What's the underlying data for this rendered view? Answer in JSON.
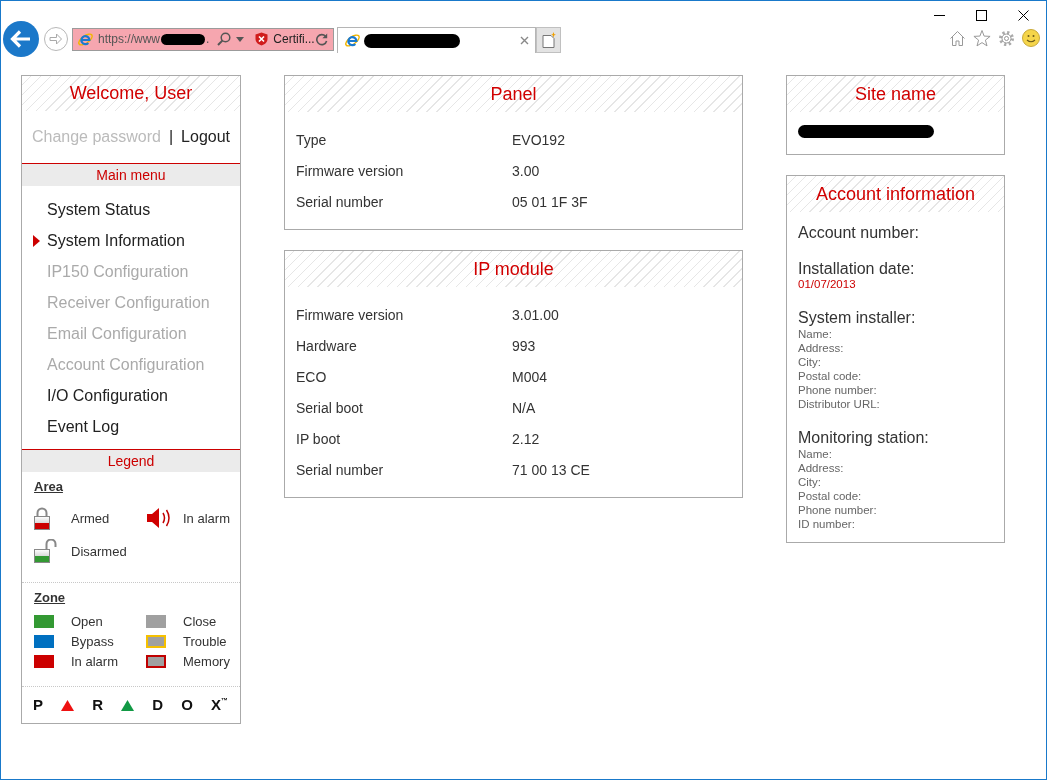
{
  "browser": {
    "address": {
      "url": "https://www",
      "url_end": ".",
      "status": "Certifi..."
    }
  },
  "sidebar": {
    "welcome": "Welcome, User",
    "account_links": [
      {
        "label": "Change password",
        "disabled": true
      },
      {
        "label": "Logout",
        "disabled": false
      }
    ],
    "link_separator": "|",
    "menu_title": "Main menu",
    "menu": [
      {
        "label": "System Status",
        "selected": false,
        "disabled": false
      },
      {
        "label": "System Information",
        "selected": true,
        "disabled": false
      },
      {
        "label": "IP150 Configuration",
        "selected": false,
        "disabled": true
      },
      {
        "label": "Receiver Configuration",
        "selected": false,
        "disabled": true
      },
      {
        "label": "Email Configuration",
        "selected": false,
        "disabled": true
      },
      {
        "label": "Account Configuration",
        "selected": false,
        "disabled": true
      },
      {
        "label": "I/O Configuration",
        "selected": false,
        "disabled": false
      },
      {
        "label": "Event Log",
        "selected": false,
        "disabled": false
      }
    ],
    "legend_title": "Legend",
    "area": {
      "title": "Area",
      "items": [
        {
          "kind": "armed",
          "label": "Armed"
        },
        {
          "kind": "alarm",
          "label": "In alarm"
        },
        {
          "kind": "disarmed",
          "label": "Disarmed"
        }
      ]
    },
    "zone": {
      "title": "Zone",
      "items": [
        {
          "label": "Open",
          "kind": "solid",
          "color": "#339933"
        },
        {
          "label": "Close",
          "kind": "solid",
          "color": "#a0a0a0"
        },
        {
          "label": "Bypass",
          "kind": "solid",
          "color": "#0070c0"
        },
        {
          "label": "Trouble",
          "kind": "outline",
          "color": "#f5c000"
        },
        {
          "label": "In alarm",
          "kind": "solid",
          "color": "#cc0000"
        },
        {
          "label": "Memory",
          "kind": "outline",
          "color": "#c00000"
        }
      ]
    },
    "logo": [
      {
        "kind": "letter",
        "text": "P"
      },
      {
        "kind": "triangle",
        "color": "#ee1111"
      },
      {
        "kind": "letter",
        "text": "R"
      },
      {
        "kind": "triangle",
        "color": "#119944"
      },
      {
        "kind": "letter",
        "text": "D"
      },
      {
        "kind": "letter",
        "text": "O"
      },
      {
        "kind": "letter",
        "text": "X$^{™}$"
      }
    ]
  },
  "panels": [
    {
      "title": "Panel",
      "rows": [
        {
          "label": "Type",
          "value": "EVO192"
        },
        {
          "label": "Firmware version",
          "value": "3.00"
        },
        {
          "label": "Serial number",
          "value": "05 01 1F 3F"
        }
      ]
    },
    {
      "title": "IP module",
      "rows": [
        {
          "label": "Firmware version",
          "value": "3.01.00"
        },
        {
          "label": "Hardware",
          "value": "993"
        },
        {
          "label": "ECO",
          "value": "M004"
        },
        {
          "label": "Serial boot",
          "value": "N/A"
        },
        {
          "label": "IP boot",
          "value": "2.12"
        },
        {
          "label": "Serial number",
          "value": "71 00 13 CE"
        }
      ]
    }
  ],
  "site": {
    "title": "Site name"
  },
  "account": {
    "title": "Account information",
    "sections": [
      {
        "heading": "Account number:"
      },
      {
        "heading": "Installation date:",
        "value": "01/07/2013"
      },
      {
        "heading": "System installer:",
        "fields": [
          "Name:",
          "Address:",
          "City:",
          "Postal code:",
          "Phone number:",
          "Distributor URL:"
        ]
      },
      {
        "heading": "Monitoring station:",
        "fields": [
          "Name:",
          "Address:",
          "City:",
          "Postal code:",
          "Phone number:",
          "ID number:"
        ]
      }
    ]
  }
}
